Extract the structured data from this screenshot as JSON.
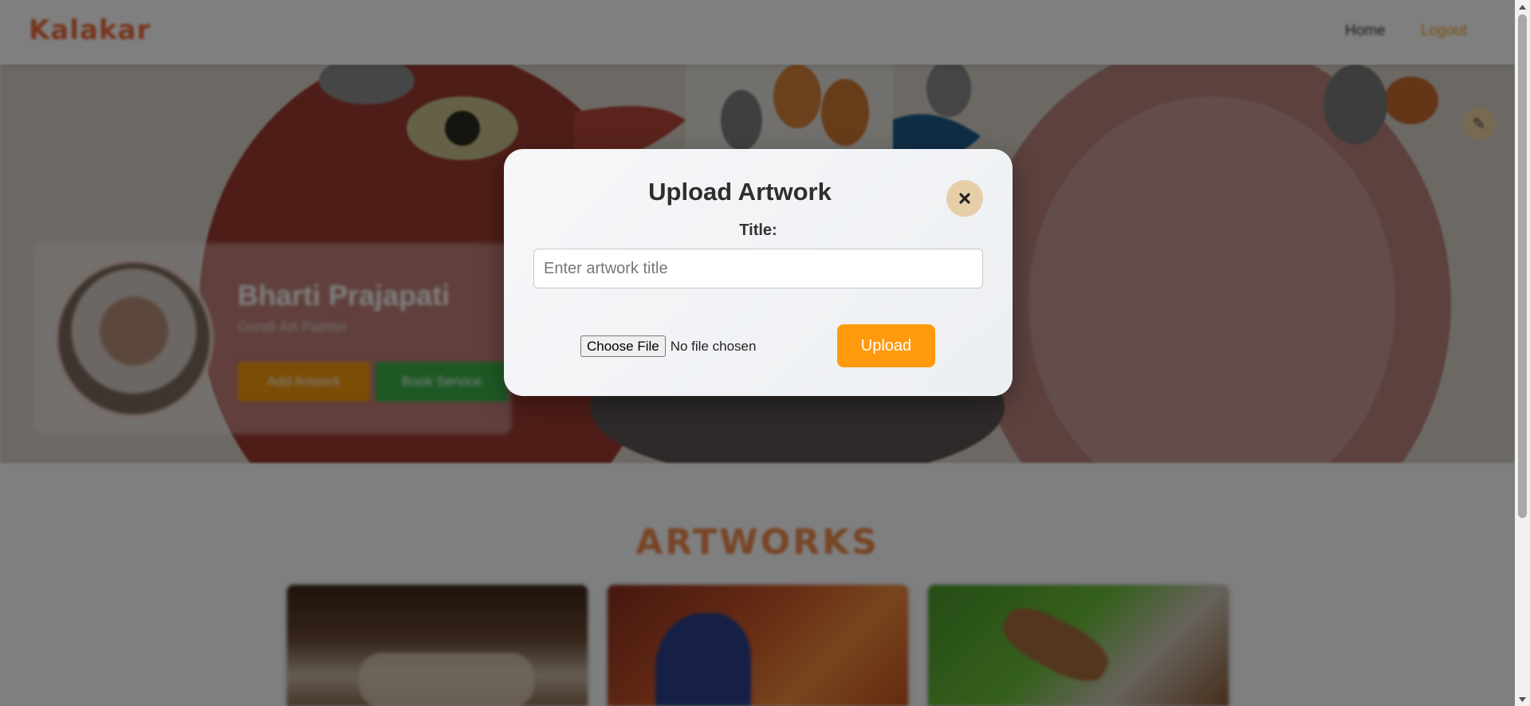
{
  "navbar": {
    "logo": "Kalakar",
    "links": [
      "Home",
      "Logout"
    ]
  },
  "profile": {
    "name": "Bharti Prajapati",
    "subtitle": "Gondi Art Painter",
    "add_artwork_label": "Add Artwork",
    "book_service_label": "Book Service"
  },
  "artworks": {
    "heading": "ARTWORKS"
  },
  "modal": {
    "title": "Upload Artwork",
    "title_label": "Title:",
    "title_placeholder": "Enter artwork title",
    "title_value": "",
    "choose_file_label": "Choose File",
    "file_status": "No file chosen",
    "upload_label": "Upload",
    "close_icon": "close-icon"
  },
  "colors": {
    "accent": "#ff9a0d",
    "logo": "#ee6a3a",
    "book": "#3db24a",
    "close_bg": "#e6cfa8"
  }
}
